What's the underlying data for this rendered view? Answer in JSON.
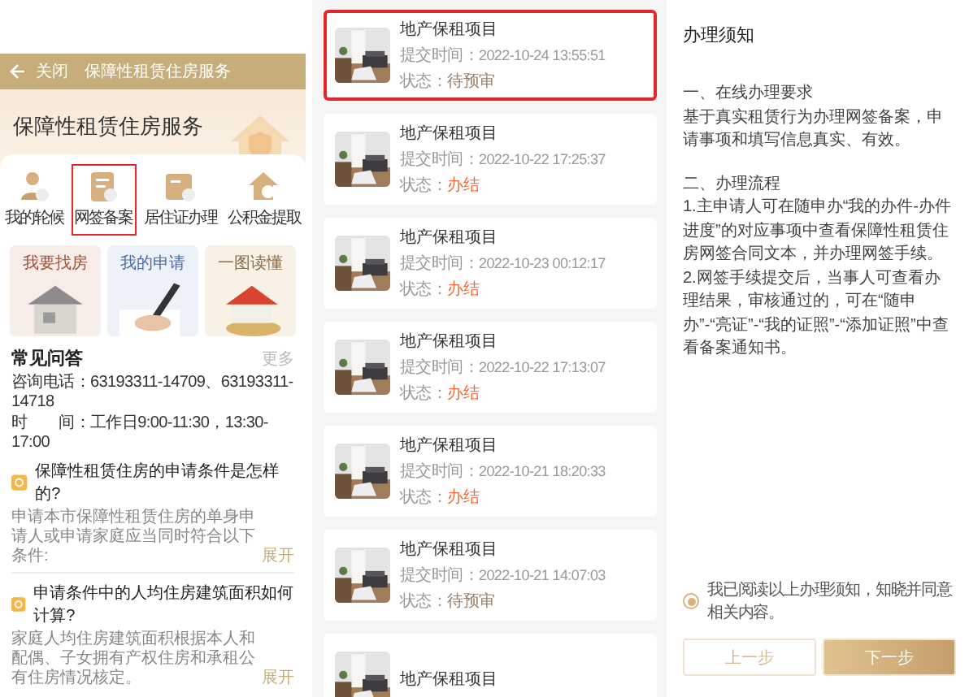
{
  "left": {
    "header": {
      "close": "关闭",
      "title": "保障性租赁住房服务"
    },
    "hero_title": "保障性租赁住房服务",
    "services": [
      {
        "label": "我的轮候",
        "selected": false
      },
      {
        "label": "网签备案",
        "selected": true
      },
      {
        "label": "居住证办理",
        "selected": false
      },
      {
        "label": "公积金提取",
        "selected": false
      }
    ],
    "tiles": [
      {
        "label": "我要找房"
      },
      {
        "label": "我的申请"
      },
      {
        "label": "一图读懂"
      }
    ],
    "faq": {
      "title": "常见问答",
      "more": "更多",
      "contact": [
        "咨询电话：63193311-14709、63193311-14718",
        "时　　间：工作日9:00-11:30，13:30-17:00"
      ],
      "items": [
        {
          "question": "保障性租赁住房的申请条件是怎样的?",
          "answer": "申请本市保障性租赁住房的单身申请人或申请家庭应当同时符合以下条件:",
          "expand": "展开"
        },
        {
          "question": "申请条件中的人均住房建筑面积如何计算?",
          "answer": "家庭人均住房建筑面积根据本人和配偶、子女拥有产权住房和承租公有住房情况核定。",
          "expand": "展开"
        }
      ]
    }
  },
  "list": {
    "items": [
      {
        "title": "地产保租项目",
        "time_label": "提交时间：",
        "time": "2022-10-24 13:55:51",
        "status_label": "状态：",
        "status": "待预审",
        "color": "#9a7f6a",
        "selected": true
      },
      {
        "title": "地产保租项目",
        "time_label": "提交时间：",
        "time": "2022-10-22 17:25:37",
        "status_label": "状态：",
        "status": "办结",
        "color": "#f06a3c",
        "selected": false
      },
      {
        "title": "地产保租项目",
        "time_label": "提交时间：",
        "time": "2022-10-23 00:12:17",
        "status_label": "状态：",
        "status": "办结",
        "color": "#f06a3c",
        "selected": false
      },
      {
        "title": "地产保租项目",
        "time_label": "提交时间：",
        "time": "2022-10-22 17:13:07",
        "status_label": "状态：",
        "status": "办结",
        "color": "#f06a3c",
        "selected": false
      },
      {
        "title": "地产保租项目",
        "time_label": "提交时间：",
        "time": "2022-10-21 18:20:33",
        "status_label": "状态：",
        "status": "办结",
        "color": "#f06a3c",
        "selected": false
      },
      {
        "title": "地产保租项目",
        "time_label": "提交时间：",
        "time": "2022-10-21 14:07:03",
        "status_label": "状态：",
        "status": "待预审",
        "color": "#9a7f6a",
        "selected": false
      },
      {
        "title": "地产保租项目"
      }
    ]
  },
  "notice": {
    "title": "办理须知",
    "paragraphs": [
      "一、在线办理要求",
      "基于真实租赁行为办理网签备案，申请事项和填写信息真实、有效。",
      "二、办理流程",
      "1.主申请人可在随申办“我的办件-办件进度”的对应事项中查看保障性租赁住房网签合同文本，并办理网签手续。",
      "2.网签手续提交后，当事人可查看办理结果，审核通过的，可在“随申办”-“亮证”-“我的证照”-“添加证照”中查看备案通知书。"
    ],
    "agree": {
      "label": "我已阅读以上办理须知，知晓并同意相关内容。",
      "checked": true
    },
    "buttons": [
      {
        "label": "上一步",
        "kind": "secondary"
      },
      {
        "label": "下一步",
        "kind": "primary"
      }
    ]
  }
}
